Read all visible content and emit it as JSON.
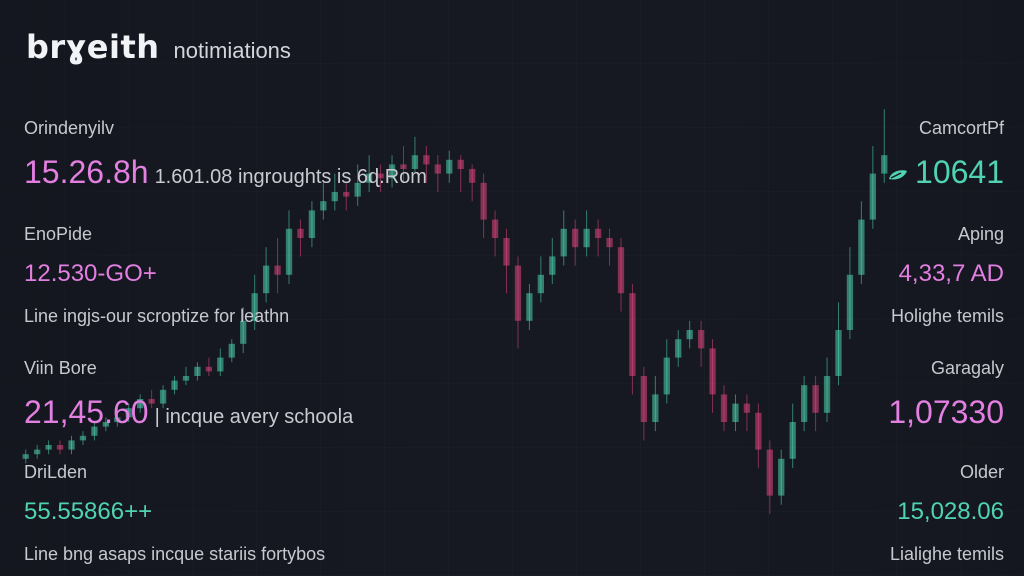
{
  "header": {
    "brand": "brɣeith",
    "subtitle": "notimiations"
  },
  "left_blocks": [
    {
      "label": "Orindenyilv",
      "value": "15.26.8h",
      "inline_note": "1.601.08 ingroughts is 6ɖ.Rom",
      "color": "#e27fe0"
    },
    {
      "label": "EnoPide",
      "value": "12.530-GO+",
      "description": "Line ingjs-our scroptize for leathn",
      "color": "#e27fe0"
    },
    {
      "label": "Viin Bore",
      "value": "21,45.60",
      "inline_note": "| incque avery schoola",
      "color": "#e27fe0"
    },
    {
      "label": "DriLden",
      "value": "55.55866++",
      "description": "Line bng asaps incque stariis fortybos",
      "color": "#4fd3b0"
    }
  ],
  "right_blocks": [
    {
      "label": "CamcortPf",
      "value": "10641",
      "icon": "leaf-icon",
      "color": "#4fd3b0"
    },
    {
      "label": "Aping",
      "value": "4,33,7 AD",
      "description": "Holighe temils",
      "color": "#e27fe0"
    },
    {
      "label": "Garagaly",
      "value": "1,07330",
      "color": "#e27fe0"
    },
    {
      "label": "Older",
      "value": "15,028.06",
      "description": "Lialighe temils",
      "color": "#4fd3b0"
    }
  ],
  "chart_data": {
    "type": "candlestick",
    "up_color": "#4fd3b0",
    "down_color": "#e0457f",
    "series": [
      [
        0.22,
        0.23,
        0.21,
        0.24
      ],
      [
        0.23,
        0.24,
        0.22,
        0.25
      ],
      [
        0.24,
        0.25,
        0.23,
        0.26
      ],
      [
        0.25,
        0.24,
        0.23,
        0.26
      ],
      [
        0.24,
        0.26,
        0.23,
        0.27
      ],
      [
        0.26,
        0.27,
        0.25,
        0.28
      ],
      [
        0.27,
        0.29,
        0.26,
        0.3
      ],
      [
        0.29,
        0.3,
        0.28,
        0.31
      ],
      [
        0.3,
        0.31,
        0.29,
        0.33
      ],
      [
        0.31,
        0.33,
        0.3,
        0.34
      ],
      [
        0.33,
        0.35,
        0.32,
        0.36
      ],
      [
        0.35,
        0.34,
        0.33,
        0.37
      ],
      [
        0.34,
        0.37,
        0.33,
        0.38
      ],
      [
        0.37,
        0.39,
        0.36,
        0.4
      ],
      [
        0.39,
        0.4,
        0.38,
        0.42
      ],
      [
        0.4,
        0.42,
        0.39,
        0.43
      ],
      [
        0.42,
        0.41,
        0.4,
        0.44
      ],
      [
        0.41,
        0.44,
        0.4,
        0.46
      ],
      [
        0.44,
        0.47,
        0.43,
        0.48
      ],
      [
        0.47,
        0.52,
        0.45,
        0.55
      ],
      [
        0.52,
        0.58,
        0.5,
        0.62
      ],
      [
        0.58,
        0.64,
        0.56,
        0.68
      ],
      [
        0.64,
        0.62,
        0.58,
        0.7
      ],
      [
        0.62,
        0.72,
        0.6,
        0.76
      ],
      [
        0.72,
        0.7,
        0.66,
        0.74
      ],
      [
        0.7,
        0.76,
        0.68,
        0.78
      ],
      [
        0.76,
        0.78,
        0.74,
        0.82
      ],
      [
        0.78,
        0.8,
        0.76,
        0.84
      ],
      [
        0.8,
        0.79,
        0.76,
        0.82
      ],
      [
        0.79,
        0.82,
        0.77,
        0.86
      ],
      [
        0.82,
        0.84,
        0.8,
        0.88
      ],
      [
        0.84,
        0.83,
        0.8,
        0.86
      ],
      [
        0.83,
        0.86,
        0.81,
        0.88
      ],
      [
        0.86,
        0.85,
        0.82,
        0.9
      ],
      [
        0.85,
        0.88,
        0.84,
        0.92
      ],
      [
        0.88,
        0.86,
        0.82,
        0.9
      ],
      [
        0.86,
        0.84,
        0.8,
        0.88
      ],
      [
        0.84,
        0.87,
        0.82,
        0.89
      ],
      [
        0.87,
        0.85,
        0.8,
        0.88
      ],
      [
        0.85,
        0.82,
        0.78,
        0.86
      ],
      [
        0.82,
        0.74,
        0.7,
        0.84
      ],
      [
        0.74,
        0.7,
        0.66,
        0.76
      ],
      [
        0.7,
        0.64,
        0.58,
        0.72
      ],
      [
        0.64,
        0.52,
        0.46,
        0.66
      ],
      [
        0.52,
        0.58,
        0.5,
        0.6
      ],
      [
        0.58,
        0.62,
        0.56,
        0.66
      ],
      [
        0.62,
        0.66,
        0.6,
        0.7
      ],
      [
        0.66,
        0.72,
        0.64,
        0.76
      ],
      [
        0.72,
        0.68,
        0.64,
        0.74
      ],
      [
        0.68,
        0.72,
        0.66,
        0.76
      ],
      [
        0.72,
        0.7,
        0.66,
        0.74
      ],
      [
        0.7,
        0.68,
        0.64,
        0.72
      ],
      [
        0.68,
        0.58,
        0.54,
        0.7
      ],
      [
        0.58,
        0.4,
        0.36,
        0.6
      ],
      [
        0.4,
        0.3,
        0.26,
        0.42
      ],
      [
        0.3,
        0.36,
        0.28,
        0.4
      ],
      [
        0.36,
        0.44,
        0.34,
        0.48
      ],
      [
        0.44,
        0.48,
        0.42,
        0.5
      ],
      [
        0.48,
        0.5,
        0.46,
        0.52
      ],
      [
        0.5,
        0.46,
        0.42,
        0.52
      ],
      [
        0.46,
        0.36,
        0.32,
        0.48
      ],
      [
        0.36,
        0.3,
        0.28,
        0.38
      ],
      [
        0.3,
        0.34,
        0.28,
        0.36
      ],
      [
        0.34,
        0.32,
        0.28,
        0.36
      ],
      [
        0.32,
        0.24,
        0.2,
        0.34
      ],
      [
        0.24,
        0.14,
        0.1,
        0.26
      ],
      [
        0.14,
        0.22,
        0.12,
        0.24
      ],
      [
        0.22,
        0.3,
        0.2,
        0.34
      ],
      [
        0.3,
        0.38,
        0.28,
        0.4
      ],
      [
        0.38,
        0.32,
        0.28,
        0.4
      ],
      [
        0.32,
        0.4,
        0.3,
        0.44
      ],
      [
        0.4,
        0.5,
        0.38,
        0.56
      ],
      [
        0.5,
        0.62,
        0.48,
        0.68
      ],
      [
        0.62,
        0.74,
        0.6,
        0.78
      ],
      [
        0.74,
        0.84,
        0.72,
        0.9
      ],
      [
        0.84,
        0.88,
        0.82,
        0.98
      ]
    ]
  }
}
